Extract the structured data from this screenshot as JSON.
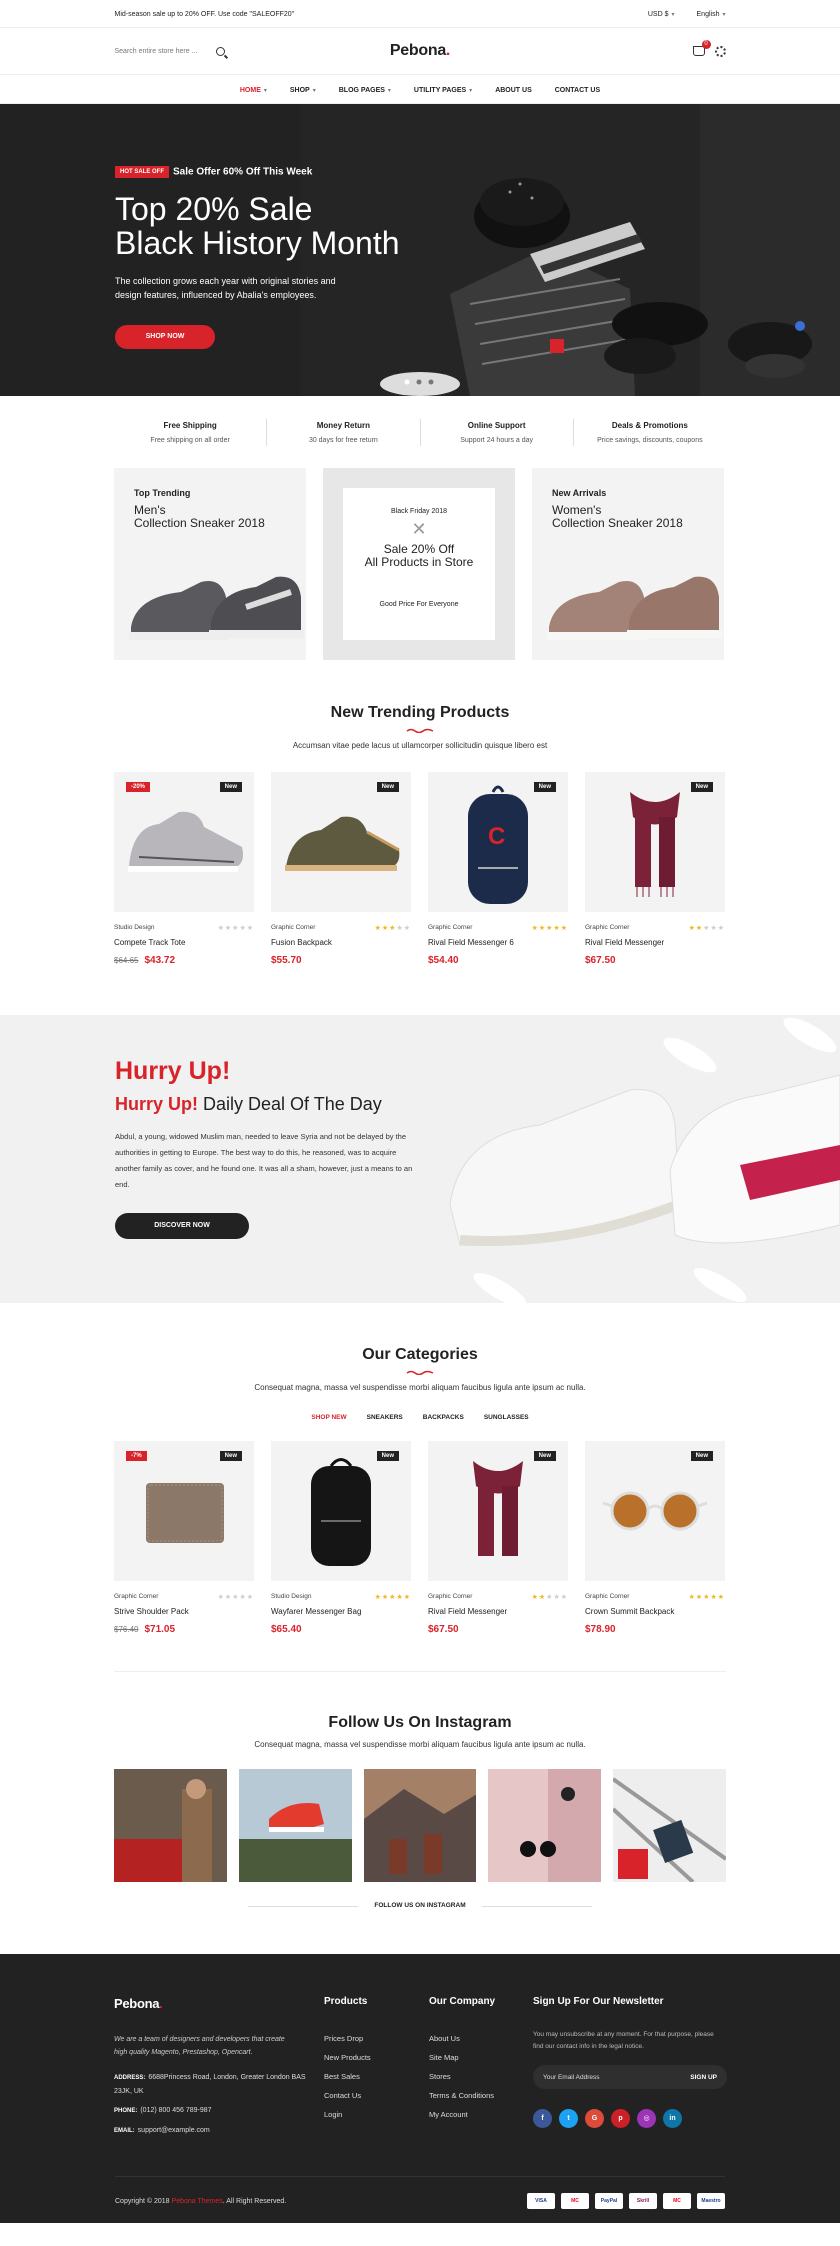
{
  "topbar": {
    "promo": "Mid-season sale up to 20% OFF. Use code \"SALEOFF20\"",
    "currency": "USD $",
    "language": "English"
  },
  "header": {
    "search_placeholder": "Search entire store here ...",
    "logo": "Pebona",
    "logo_dot": ".",
    "cart_count": "0"
  },
  "nav": [
    "HOME",
    "SHOP",
    "BLOG PAGES",
    "UTILITY PAGES",
    "ABOUT US",
    "CONTACT US"
  ],
  "hero": {
    "badge": "HOT SALE OFF",
    "subtitle": "Sale Offer 60% Off This Week",
    "title_line1": "Top 20% Sale",
    "title_line2": "Black History Month",
    "text": "The collection grows each year with original stories and design features, influenced by Abalia's employees.",
    "button": "SHOP NOW"
  },
  "features": [
    {
      "title": "Free Shipping",
      "desc": "Free shipping on all order"
    },
    {
      "title": "Money Return",
      "desc": "30 days for free return"
    },
    {
      "title": "Online Support",
      "desc": "Support 24 hours a day"
    },
    {
      "title": "Deals & Promotions",
      "desc": "Price savings, discounts, coupons"
    }
  ],
  "banners": {
    "left": {
      "label": "Top Trending",
      "line1": "Men's",
      "line2": "Collection Sneaker 2018"
    },
    "mid": {
      "top": "Black Friday 2018",
      "line1": "Sale 20% Off",
      "line2": "All Products in Store",
      "bottom": "Good Price For Everyone"
    },
    "right": {
      "label": "New Arrivals",
      "line1": "Women's",
      "line2": "Collection Sneaker 2018"
    }
  },
  "trending": {
    "title": "New Trending Products",
    "subtitle": "Accumsan vitae pede lacus ut ullamcorper sollicitudin quisque libero est",
    "products": [
      {
        "brand": "Studio Design",
        "name": "Compete Track Tote",
        "old": "$64.65",
        "price": "$43.72",
        "sale": "-20%",
        "tag": "New",
        "rating": 0
      },
      {
        "brand": "Graphic Corner",
        "name": "Fusion Backpack",
        "old": "",
        "price": "$55.70",
        "sale": "",
        "tag": "New",
        "rating": 3
      },
      {
        "brand": "Graphic Corner",
        "name": "Rival Field Messenger 6",
        "old": "",
        "price": "$54.40",
        "sale": "",
        "tag": "New",
        "rating": 5
      },
      {
        "brand": "Graphic Corner",
        "name": "Rival Field Messenger",
        "old": "",
        "price": "$67.50",
        "sale": "",
        "tag": "New",
        "rating": 2
      }
    ]
  },
  "deal": {
    "title": "Hurry Up!",
    "sub_red": "Hurry Up!",
    "sub_black": "Daily Deal Of The Day",
    "text": "Abdul, a young, widowed Muslim man, needed to leave Syria and not be delayed by the authorities in getting to Europe. The best way to do this, he reasoned, was to acquire another family as cover, and he found one. It was all a sham, however, just a means to an end.",
    "button": "DISCOVER NOW"
  },
  "categories": {
    "title": "Our Categories",
    "subtitle": "Consequat magna, massa vel suspendisse morbi aliquam faucibus ligula ante ipsum ac nulla.",
    "tabs": [
      "SHOP NEW",
      "SNEAKERS",
      "BACKPACKS",
      "SUNGLASSES"
    ],
    "products": [
      {
        "brand": "Graphic Corner",
        "name": "Strive Shoulder Pack",
        "old": "$76.40",
        "price": "$71.05",
        "sale": "-7%",
        "tag": "New",
        "rating": 0
      },
      {
        "brand": "Studio Design",
        "name": "Wayfarer Messenger Bag",
        "old": "",
        "price": "$65.40",
        "sale": "",
        "tag": "New",
        "rating": 5
      },
      {
        "brand": "Graphic Corner",
        "name": "Rival Field Messenger",
        "old": "",
        "price": "$67.50",
        "sale": "",
        "tag": "New",
        "rating": 2
      },
      {
        "brand": "Graphic Corner",
        "name": "Crown Summit Backpack",
        "old": "",
        "price": "$78.90",
        "sale": "",
        "tag": "New",
        "rating": 5
      }
    ]
  },
  "instagram": {
    "title": "Follow Us On Instagram",
    "subtitle": "Consequat magna, massa vel suspendisse morbi aliquam faucibus ligula ante ipsum ac nulla.",
    "link": "FOLLOW US ON INSTAGRAM"
  },
  "footer": {
    "logo": "Pebona",
    "about": "We are a team of designers and developers that create high quality Magento, Prestashop, Opencart.",
    "address_label": "ADDRESS:",
    "address": "6688Princess Road, London, Greater London BAS 23JK, UK",
    "phone_label": "PHONE:",
    "phone": "(012) 800 456 789-987",
    "email_label": "EMAIL:",
    "email": "support@example.com",
    "products_title": "Products",
    "products": [
      "Prices Drop",
      "New Products",
      "Best Sales",
      "Contact Us",
      "Login"
    ],
    "company_title": "Our Company",
    "company": [
      "About Us",
      "Site Map",
      "Stores",
      "Terms & Conditions",
      "My Account"
    ],
    "newsletter_title": "Sign Up For Our Newsletter",
    "newsletter_text": "You may unsubscribe at any moment. For that purpose, please find our contact info in the legal notice.",
    "email_placeholder": "Your Email Address",
    "signup": "SIGN UP",
    "copyright_pre": "Copyright © 2018 ",
    "copyright_brand": "Pebona Themes",
    "copyright_post": ". All Right Reserved.",
    "payments": [
      "VISA",
      "MC",
      "PayPal",
      "Skrill",
      "MC",
      "Maestro"
    ]
  },
  "colors": {
    "accent": "#d8232a",
    "dark": "#222222"
  }
}
